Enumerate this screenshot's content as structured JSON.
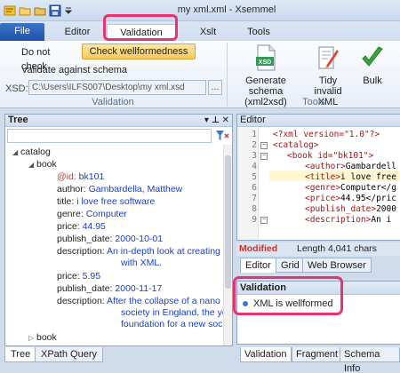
{
  "window": {
    "title": "my xml.xml - Xsemmel"
  },
  "ribbon_tabs": [
    {
      "label": "File"
    },
    {
      "label": "Editor"
    },
    {
      "label": "Validation"
    },
    {
      "label": "Xslt"
    },
    {
      "label": "Tools"
    }
  ],
  "validation_group": {
    "do_not_check": "Do not check",
    "check_wellformedness": "Check wellformedness",
    "validate_against_schema": "Validate against schema",
    "xsd_label": "XSD:",
    "xsd_path": "C:\\Users\\ILFS007\\Desktop\\my xml.xsd",
    "browse": "...",
    "group_label": "Validation"
  },
  "tools_group": {
    "generate_schema": "Generate schema",
    "generate_schema_sub": "(xml2xsd)",
    "tidy_invalid": "Tidy invalid",
    "tidy_invalid_sub": "XML",
    "bulk": "Bulk",
    "xsd_icon_text": "XSD",
    "group_label": "Tools"
  },
  "tree": {
    "title": "Tree",
    "header_icons": "▾ ⊥ ✕",
    "nodes": [
      {
        "label": "catalog"
      },
      {
        "label": "book"
      },
      {
        "key": "@id:",
        "value": "bk101"
      },
      {
        "key": "author:",
        "value": "Gambardella, Matthew"
      },
      {
        "key": "title:",
        "value": "i love free software"
      },
      {
        "key": "genre:",
        "value": "Computer"
      },
      {
        "key": "price:",
        "value": "44.95"
      },
      {
        "key": "publish_date:",
        "value": "2000-10-01"
      },
      {
        "key": "description:",
        "value": "An in-depth look at creating",
        "value2": "with XML."
      },
      {
        "key": "price:",
        "value": "5.95"
      },
      {
        "key": "publish_date:",
        "value": "2000-11-17"
      },
      {
        "key": "description:",
        "value": "After the collapse of a nano",
        "value2": "society in England, the yo",
        "value3": "foundation for a new soc"
      },
      {
        "label": "book"
      }
    ],
    "tabs": [
      {
        "label": "Tree"
      },
      {
        "label": "XPath Query"
      }
    ]
  },
  "editor": {
    "title": "Editor",
    "lines": [
      {
        "num": "1",
        "text": "<?xml version=\"1.0\"?>"
      },
      {
        "num": "2",
        "text": "<catalog>"
      },
      {
        "num": "3",
        "text": "<book id=\"bk101\">"
      },
      {
        "num": "4",
        "tag": "<author>",
        "txt": "Gambardell"
      },
      {
        "num": "5",
        "tag": "<title>",
        "txt": "i love free"
      },
      {
        "num": "6",
        "tag": "<genre>",
        "txt": "Computer</g"
      },
      {
        "num": "7",
        "tag": "<price>",
        "txt": "44.95</pric"
      },
      {
        "num": "8",
        "tag": "<publish_date>",
        "txt": "2000"
      },
      {
        "num": "9",
        "tag": "<description>",
        "txt": "An i"
      }
    ],
    "status_modified": "Modified",
    "status_length": "Length 4,041 chars",
    "tabs": [
      {
        "label": "Editor"
      },
      {
        "label": "Grid"
      },
      {
        "label": "Web Browser"
      }
    ]
  },
  "validation_panel": {
    "title": "Validation",
    "message": "XML is wellformed",
    "tabs": [
      {
        "label": "Validation"
      },
      {
        "label": "Fragment"
      },
      {
        "label": "Schema Info"
      }
    ]
  },
  "colors": {
    "accent": "#e8336f",
    "file_tab": "#2b5fb8",
    "selected_button": "#f8c95a"
  }
}
